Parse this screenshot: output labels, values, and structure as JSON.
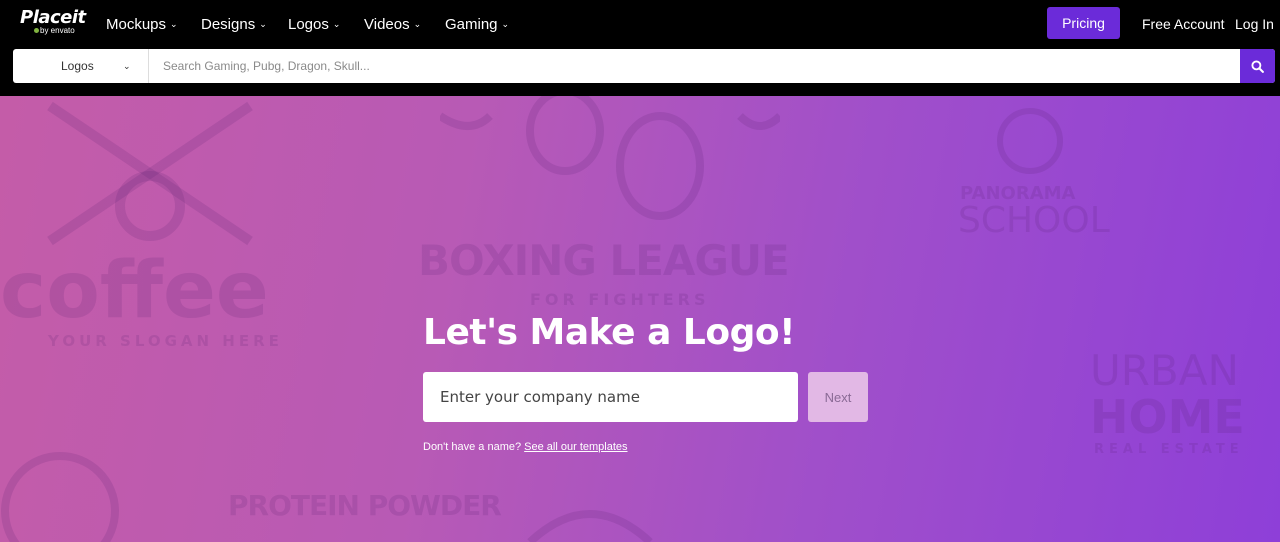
{
  "brand": {
    "name": "Placeit",
    "sub": "by envato"
  },
  "nav": {
    "items": [
      {
        "label": "Mockups"
      },
      {
        "label": "Designs"
      },
      {
        "label": "Logos"
      },
      {
        "label": "Videos"
      },
      {
        "label": "Gaming"
      }
    ],
    "pricing": "Pricing",
    "free_account": "Free Account",
    "login": "Log In"
  },
  "search": {
    "category": "Logos",
    "placeholder": "Search Gaming, Pubg, Dragon, Skull...",
    "value": ""
  },
  "hero": {
    "title": "Let's Make a Logo!",
    "input_placeholder": "Enter your company name",
    "next_label": "Next",
    "hint_text": "Don't have a name?",
    "hint_link": "See all our templates"
  },
  "background_logos": {
    "coffee": "coffee",
    "coffee_tagline": "YOUR SLOGAN HERE",
    "boxing": "BOXING LEAGUE",
    "boxing_tagline": "FOR FIGHTERS",
    "school_top": "PANORAMA",
    "school": "SCHOOL",
    "urban": "URBAN",
    "home": "HOME",
    "home_tagline": "REAL ESTATE",
    "protein": "PROTEIN POWDER"
  },
  "colors": {
    "accent": "#6b2bd9",
    "hero_start": "#c45ca8",
    "hero_end": "#8e3fd8",
    "next_bg": "#e2b8e5"
  },
  "icons": {
    "search": "search-icon",
    "chevron": "chevron-down-icon"
  }
}
